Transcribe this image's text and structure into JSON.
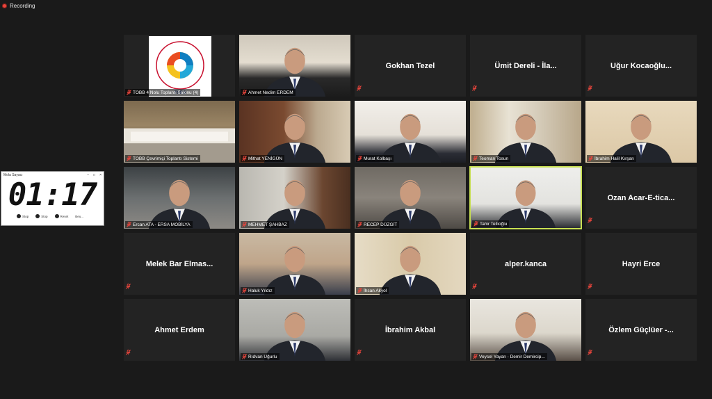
{
  "recording": {
    "label": "Recording"
  },
  "stopwatch": {
    "title": "Mola Sayacı",
    "time": "01:17",
    "window_controls": [
      "–",
      "□",
      "×"
    ],
    "buttons": [
      "Stop",
      "Stop",
      "Reset",
      "Beu..."
    ]
  },
  "participants": [
    {
      "name": "TOBB 4 Nolu Toplantı Salonu (4)",
      "video": true,
      "kind": "logo",
      "logo_text": "TÜRKİYE ODALAR VE BORSALAR BİRLİĞİ",
      "logo_short": "TOBB"
    },
    {
      "name": "Ahmet Nedim ERDEM",
      "video": true,
      "kind": "office"
    },
    {
      "name": "Gokhan Tezel",
      "video": false
    },
    {
      "name": "Ümit Dereli - İla...",
      "video": false
    },
    {
      "name": "Uğur Kocaoğlu...",
      "video": false
    },
    {
      "name": "TOBB Çevrimiçi Toplantı Sistemi",
      "video": true,
      "kind": "hall"
    },
    {
      "name": "Mithat YENİGÜN",
      "video": true,
      "kind": "wood"
    },
    {
      "name": "Murat Kolbaşı",
      "video": true,
      "kind": "bright"
    },
    {
      "name": "Teoman Tosun",
      "video": true,
      "kind": "curtain"
    },
    {
      "name": "İbrahim Halil Kırşan",
      "video": true,
      "kind": "wall"
    },
    {
      "name": "Ercan ATA - ERSA MOBİLYA",
      "video": true,
      "kind": "shop"
    },
    {
      "name": "MEHMET ŞAHBAZ",
      "video": true,
      "kind": "flag"
    },
    {
      "name": "RECEP DÜZGİT",
      "video": true,
      "kind": "room"
    },
    {
      "name": "Tahir Tellioğlu",
      "video": true,
      "kind": "plain",
      "active": true
    },
    {
      "name": "Ozan Acar-E-tica...",
      "video": false
    },
    {
      "name": "Melek Bar Elmas...",
      "video": false
    },
    {
      "name": "Haluk Yıldız",
      "video": true,
      "kind": "closeup"
    },
    {
      "name": "İhsan Akyol",
      "video": true,
      "kind": "wallpaper"
    },
    {
      "name": "alper.kanca",
      "video": false
    },
    {
      "name": "Hayri Erce",
      "video": false
    },
    {
      "name": "Ahmet Erdem",
      "video": false
    },
    {
      "name": "Rıdvan Uğurlu",
      "video": true,
      "kind": "grey"
    },
    {
      "name": "İbrahim Akbal",
      "video": false
    },
    {
      "name": "Veysel Yayan - Demir Demircip...",
      "video": true,
      "kind": "mask"
    },
    {
      "name": "Özlem Güçlüer -...",
      "video": false
    }
  ],
  "colors": {
    "muted_mic": "#e8453c",
    "active_speaker": "#c8e052",
    "tile_bg": "#232323"
  }
}
